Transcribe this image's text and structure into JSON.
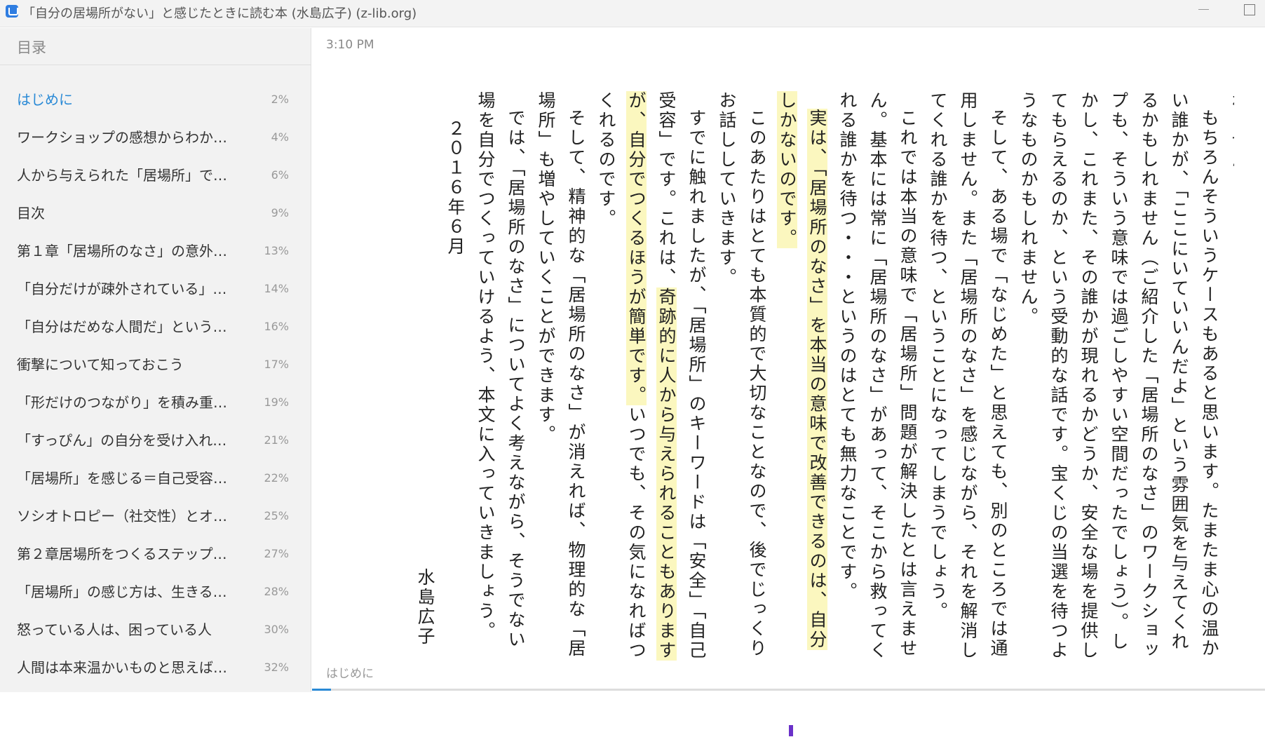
{
  "window": {
    "title": "「自分の居場所がない」と感じたときに読む本 (水島広子) (z-lib.org)"
  },
  "sidebar": {
    "header": "目录",
    "items": [
      {
        "label": "はじめに",
        "pct": "2%",
        "active": true
      },
      {
        "label": "ワークショップの感想からわか…",
        "pct": "4%"
      },
      {
        "label": "人から与えられた「居場所」で…",
        "pct": "6%"
      },
      {
        "label": "目次",
        "pct": "9%"
      },
      {
        "label": "第１章「居場所のなさ」の意外…",
        "pct": "13%"
      },
      {
        "label": "「自分だけが疎外されている」…",
        "pct": "14%"
      },
      {
        "label": "「自分はだめな人間だ」という…",
        "pct": "16%"
      },
      {
        "label": "衝撃について知っておこう",
        "pct": "17%"
      },
      {
        "label": "「形だけのつながり」を積み重…",
        "pct": "19%"
      },
      {
        "label": "「すっぴん」の自分を受け入れ…",
        "pct": "21%"
      },
      {
        "label": "「居場所」を感じる＝自己受容…",
        "pct": "22%"
      },
      {
        "label": "ソシオトロピー（社交性）とオ…",
        "pct": "25%"
      },
      {
        "label": "第２章居場所をつくるステップ…",
        "pct": "27%"
      },
      {
        "label": "「居場所」の感じ方は、生きる…",
        "pct": "28%"
      },
      {
        "label": "怒っている人は、困っている人",
        "pct": "30%"
      },
      {
        "label": "人間は本来温かいものと思えば…",
        "pct": "32%"
      }
    ]
  },
  "reader": {
    "clock": "3:10 PM",
    "chapter": "はじめに",
    "progress_fraction": 0.02,
    "paragraphs": [
      {
        "id": "p0",
        "text": "れません。"
      },
      {
        "id": "p1",
        "text": "もちろんそういうケースもあると思います。たまたま心の温かい誰かが、「ここにいていいんだよ」という雰囲気を与えてくれるかもしれません（ご紹介した「居場所のなさ」のワークショップも、そういう意味では過ごしやすい空間だったでしょう）。しかし、これまた、その誰かが現れるかどうか、安全な場を提供してもらえるのか、という受動的な話です。宝くじの当選を待つようなものかもしれません。"
      },
      {
        "id": "p2",
        "text": "そして、ある場で「なじめた」と思えても、別のところでは通用しません。また「居場所のなさ」を感じながら、それを解消してくれる誰かを待つ、ということになってしまうでしょう。"
      },
      {
        "id": "p3",
        "text": "これでは本当の意味で「居場所」問題が解決したとは言えません。基本には常に「居場所のなさ」があって、そこから救ってくれる誰かを待つ・・・というのはとても無力なことです。"
      },
      {
        "id": "p4",
        "text": "実は、「居場所のなさ」を本当の意味で改善できるのは、自分しかないのです。"
      },
      {
        "id": "p5",
        "text": "このあたりはとても本質的で大切なことなので、後でじっくりお話ししていきます。"
      },
      {
        "id": "p6a",
        "text": "すでに触れましたが、「居場所」のキーワードは「安全」「自己受容」です。これは、"
      },
      {
        "id": "p6b",
        "text": "奇跡的に人から与えられることもありますが、自分でつくるほうが簡単です。"
      },
      {
        "id": "p6c",
        "text": "いつでも、その気になればつくれるのです。"
      },
      {
        "id": "p7",
        "text": "そして、精神的な「居場所のなさ」が消えれば、物理的な「居場所」も増やしていくことができます。"
      },
      {
        "id": "p8",
        "text": "では、「居場所のなさ」についてよく考えながら、そうでない場を自分でつくっていけるよう、本文に入っていきましょう。"
      },
      {
        "id": "date",
        "text": "２０１６年６月"
      },
      {
        "id": "author",
        "text": "水島広子"
      }
    ]
  },
  "colors": {
    "accent": "#2a8ad6",
    "highlight": "#fbf7bf",
    "sidebar_bg": "#f2f2f2",
    "cursor": "#6a31c9"
  }
}
